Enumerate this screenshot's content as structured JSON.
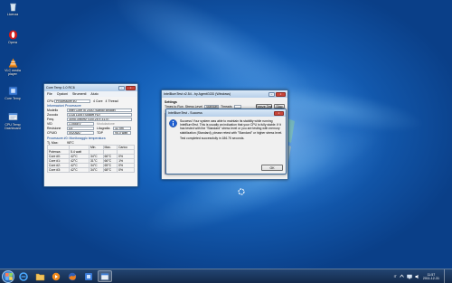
{
  "desktop": {
    "icons": [
      {
        "label": "Licenza",
        "icon": "recycle-bin-icon"
      },
      {
        "label": "Opera",
        "icon": "opera-icon"
      },
      {
        "label": "VLC media player",
        "icon": "vlc-icon"
      },
      {
        "label": "Core Temp",
        "icon": "core-temp-icon"
      },
      {
        "label": "CPU Temp Dashboard",
        "icon": "program-icon"
      }
    ]
  },
  "coretemp": {
    "title": "Core Temp 1.0 RC6",
    "menu": [
      "File",
      "Opzioni",
      "Strumenti",
      "Aiuto"
    ],
    "select_label": "CPU",
    "processor_select": "Processore #0",
    "cores_value": "4",
    "cores_label": "Core",
    "threads_value": "4",
    "threads_label": "Thread",
    "section_info": "Informazioni Processore",
    "rows": [
      {
        "label": "Modello",
        "value": "Intel Core i5 2400 (Sandy Bridge)"
      },
      {
        "label": "Zoccolo",
        "value": "LGA 1155 (Socket H2)"
      },
      {
        "label": "Freq.",
        "value": "3095.39MHz (100.25 x 31.0)"
      },
      {
        "label": "VID",
        "value": "1.0558 v"
      },
      {
        "label": "Revisione",
        "value": "D2"
      },
      {
        "label": "CPUID",
        "value": "0x206A7"
      }
    ],
    "modulation_label": "Modulazione",
    "lithography_label": "Litografia",
    "lithography_value": "32 nm",
    "tdp_label": "TDP",
    "tdp_value": "95.0 watt",
    "section_temp": "Processore #0: Monitoraggio temperatura",
    "tjmax_label": "Tj. Max:",
    "tjmax_value": "98°C",
    "temp_headers": [
      "",
      "",
      "Min.",
      "Max.",
      "Carico"
    ],
    "temps": [
      {
        "name": "Potenza:",
        "value": "5.4 watt",
        "min": "",
        "max": "",
        "load": ""
      },
      {
        "name": "Core #0:",
        "value": "42°C",
        "min": "34°C",
        "max": "66°C",
        "load": "0%"
      },
      {
        "name": "Core #1:",
        "value": "42°C",
        "min": "31°C",
        "max": "66°C",
        "load": "1%"
      },
      {
        "name": "Core #2:",
        "value": "42°C",
        "min": "34°C",
        "max": "65°C",
        "load": "0%"
      },
      {
        "name": "Core #3:",
        "value": "42°C",
        "min": "34°C",
        "max": "68°C",
        "load": "0%"
      }
    ]
  },
  "intelburn": {
    "title": "IntelBurnTest v2.54 - by AgentGOD (Windows)",
    "settings_label": "Settings",
    "controls": [
      "Times to Run",
      "Stress Level",
      "Standard",
      "Threads",
      "Stop"
    ],
    "freeze_label": "Freeze Test",
    "columns": [
      "Time",
      "Speed",
      "GFlops",
      "Results"
    ]
  },
  "dialog": {
    "title": "IntelBurnTest - Success",
    "message": "Success! Your system was able to maintain its stability while running IntelBurnTest. This is usually an indication that your CPU is fully stable. If it has tested with the \"Standard\" stress level or you are testing with memory stabilization (Standard), please retest with \"Standard\" or higher stress level.",
    "completion": "Test completed successfully in 186.75 seconds.",
    "ok_label": "OK"
  },
  "taskbar": {
    "time": "11:57",
    "date": "2011-12-31",
    "language": "IT",
    "pinned": [
      "ie-icon",
      "folder-icon",
      "media-player-icon",
      "firefox-icon",
      "core-temp-icon",
      "intelburn-icon"
    ]
  },
  "colors": {
    "desktop_blue": "#1a6bc4",
    "window_border": "#3d6a99",
    "info_icon_blue": "#1f5fd0"
  }
}
